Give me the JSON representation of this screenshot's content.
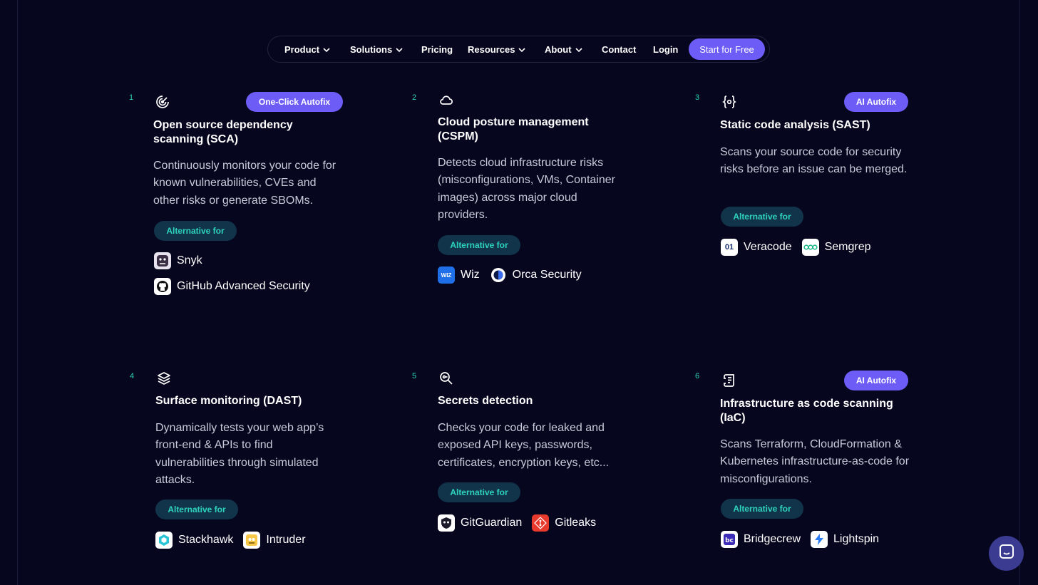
{
  "nav": {
    "items": [
      {
        "label": "Product",
        "dropdown": true
      },
      {
        "label": "Solutions",
        "dropdown": true
      },
      {
        "label": "Pricing",
        "dropdown": false
      },
      {
        "label": "Resources",
        "dropdown": true
      },
      {
        "label": "About",
        "dropdown": true
      },
      {
        "label": "Contact",
        "dropdown": false
      },
      {
        "label": "Login",
        "dropdown": false
      }
    ],
    "cta_label": "Start for Free"
  },
  "colors": {
    "background": "#06061f",
    "accent": "#6d5cf6",
    "teal": "#2ed3b7",
    "pill_bg": "#12344a"
  },
  "alt_label": "Alternative for",
  "cards": [
    {
      "number": "1",
      "icon": "radar-icon",
      "badge": "One-Click Autofix",
      "title": "Open source dependency scanning (SCA)",
      "description": "Continuously monitors your code for known vulnerabilities, CVEs and other risks or generate SBOMs.",
      "alternatives": [
        {
          "name": "Snyk",
          "icon": "snyk-logo"
        },
        {
          "name": "GitHub Advanced Security",
          "icon": "github-logo"
        }
      ]
    },
    {
      "number": "2",
      "icon": "cloud-icon",
      "badge": "",
      "title": "Cloud posture management (CSPM)",
      "description": "Detects cloud infrastructure risks (misconfigurations, VMs, Container images) across major cloud providers.",
      "alternatives": [
        {
          "name": "Wiz",
          "icon": "wiz-logo"
        },
        {
          "name": "Orca Security",
          "icon": "orca-logo"
        }
      ]
    },
    {
      "number": "3",
      "icon": "code-scan-icon",
      "badge": "AI Autofix",
      "title": "Static code analysis (SAST)",
      "description": "Scans your source code for security risks before an issue can be merged.",
      "alternatives": [
        {
          "name": "Veracode",
          "icon": "veracode-logo"
        },
        {
          "name": "Semgrep",
          "icon": "semgrep-logo"
        }
      ]
    },
    {
      "number": "4",
      "icon": "layers-icon",
      "badge": "",
      "title": "Surface monitoring (DAST)",
      "description": "Dynamically tests your web app’s front-end & APIs to find vulnerabilities through simulated attacks.",
      "alternatives": [
        {
          "name": "Stackhawk",
          "icon": "stackhawk-logo"
        },
        {
          "name": "Intruder",
          "icon": "intruder-logo"
        }
      ]
    },
    {
      "number": "5",
      "icon": "key-search-icon",
      "badge": "",
      "title": "Secrets detection",
      "description": "Checks your code for leaked and exposed API keys, passwords, certificates, encryption keys, etc...",
      "alternatives": [
        {
          "name": "GitGuardian",
          "icon": "gitguardian-logo"
        },
        {
          "name": "Gitleaks",
          "icon": "gitleaks-logo"
        }
      ]
    },
    {
      "number": "6",
      "icon": "scroll-code-icon",
      "badge": "AI Autofix",
      "title": "Infrastructure as code scanning (IaC)",
      "description": "Scans Terraform, CloudFormation & Kubernetes infrastructure-as-code for misconfigurations.",
      "alternatives": [
        {
          "name": "Bridgecrew",
          "icon": "bridgecrew-logo"
        },
        {
          "name": "Lightspin",
          "icon": "lightspin-logo"
        }
      ]
    }
  ],
  "chat": {
    "icon": "chat-icon"
  }
}
